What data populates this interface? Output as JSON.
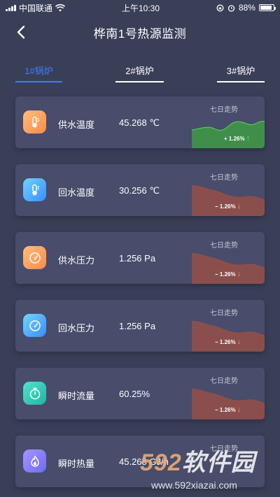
{
  "status_bar": {
    "carrier": "中国联通",
    "time": "上午10:30",
    "battery": "88%"
  },
  "header": {
    "title": "桦南1号热源监测"
  },
  "tabs": [
    {
      "label": "1#锅炉"
    },
    {
      "label": "2#锅炉"
    },
    {
      "label": "3#锅炉"
    }
  ],
  "trend_title": "七日走势",
  "cards": [
    {
      "label": "供水温度",
      "value": "45.268 ℃",
      "pct": "+ 1.26%",
      "direction": "up"
    },
    {
      "label": "回水温度",
      "value": "30.256 ℃",
      "pct": "− 1.26%",
      "direction": "down"
    },
    {
      "label": "供水压力",
      "value": "1.256 Pa",
      "pct": "− 1.26%",
      "direction": "down"
    },
    {
      "label": "回水压力",
      "value": "1.256 Pa",
      "pct": "− 1.26%",
      "direction": "down"
    },
    {
      "label": "瞬时流量",
      "value": "60.25%",
      "pct": "− 1.26%",
      "direction": "down"
    },
    {
      "label": "瞬时热量",
      "value": "45.268 GJ/h",
      "pct": "",
      "direction": ""
    }
  ],
  "watermark": {
    "logo_number": "592",
    "logo_text": "软件园",
    "url": "www.592xiazai.com"
  },
  "colors": {
    "background": "#3a3f58",
    "card": "#474d6a",
    "active_tab": "#3d7bff",
    "trend_up_fill": "#3f8f4a",
    "trend_down_fill": "#8a4f4c",
    "arrow_up": "#5fe36a",
    "arrow_down": "#ff9146"
  }
}
